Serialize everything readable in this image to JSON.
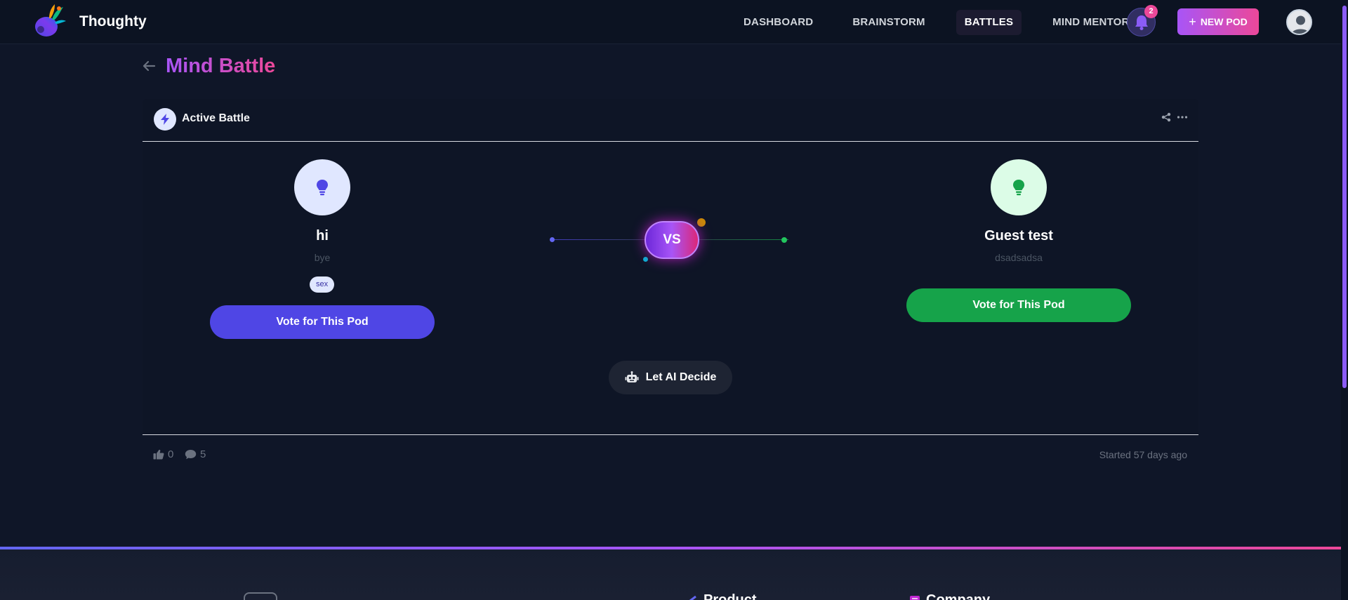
{
  "app": {
    "name": "Thoughty"
  },
  "nav": {
    "items": [
      {
        "label": "DASHBOARD",
        "active": false
      },
      {
        "label": "BRAINSTORM",
        "active": false
      },
      {
        "label": "BATTLES",
        "active": true
      },
      {
        "label": "MIND MENTOR",
        "active": false
      }
    ],
    "notification_count": "2",
    "new_pod_label": "NEW POD"
  },
  "page": {
    "title": "Mind Battle"
  },
  "battle": {
    "status_label": "Active Battle",
    "vs_label": "VS",
    "left_pod": {
      "name": "hi",
      "description": "bye",
      "tag": "sex",
      "vote_label": "Vote for This Pod",
      "color": "#4f46e5",
      "icon": "lightbulb-icon"
    },
    "right_pod": {
      "name": "Guest test",
      "description": "dsadsadsa",
      "vote_label": "Vote for This Pod",
      "color": "#16a34a",
      "icon": "lightbulb-icon"
    },
    "ai_decide_label": "Let AI Decide",
    "likes": "0",
    "comments": "5",
    "started": "Started 57 days ago"
  },
  "footer": {
    "columns": [
      "Product",
      "Company"
    ]
  },
  "colors": {
    "accent_purple": "#a855f7",
    "accent_pink": "#ec4899",
    "background": "#0f1628"
  }
}
